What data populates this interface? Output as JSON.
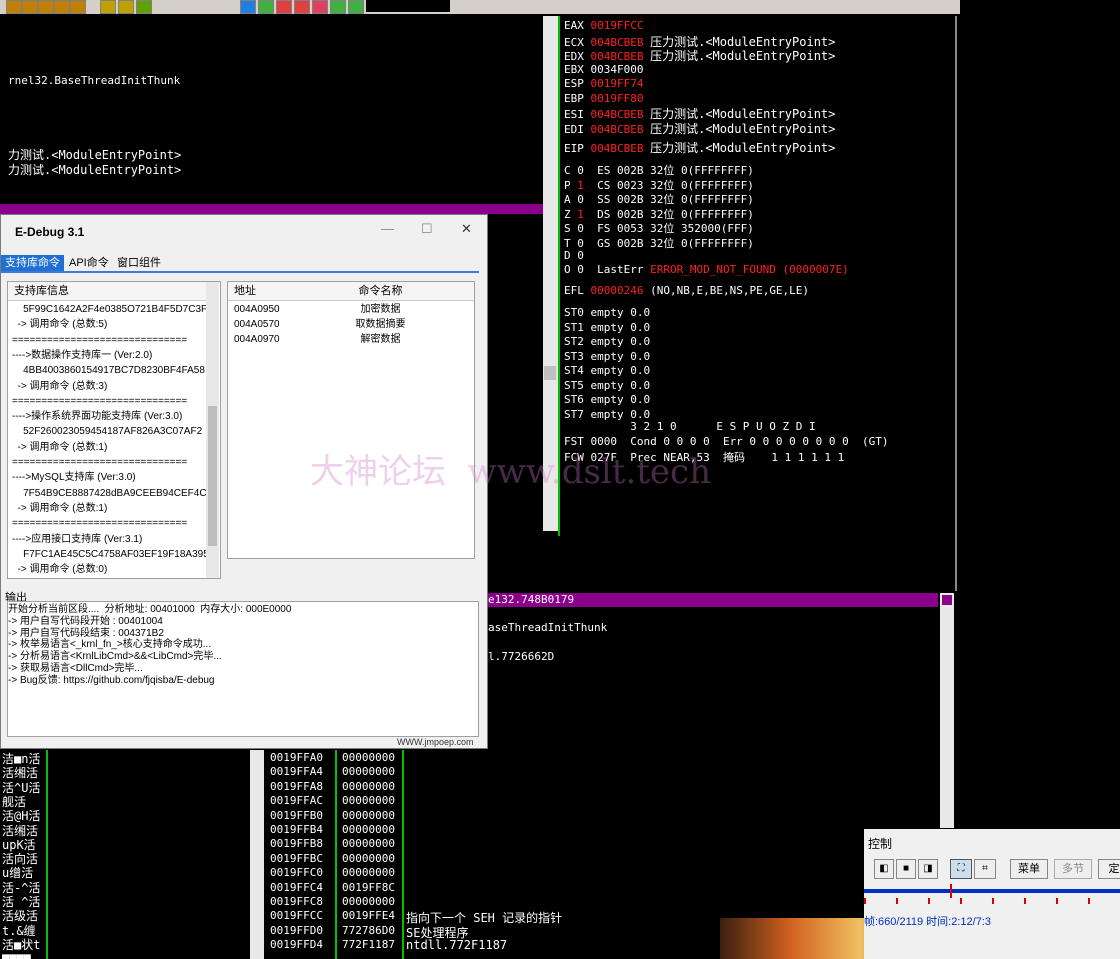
{
  "disasm": {
    "lines": [
      "rnel32.BaseThreadInitThunk",
      "力测试.<ModuleEntryPoint>",
      "力测试.<ModuleEntryPoint>"
    ]
  },
  "registers": {
    "lines": [
      {
        "name": "EAX",
        "value": "0019FFCC",
        "red": true,
        "extra": ""
      },
      {
        "name": "ECX",
        "value": "004BCBEB",
        "red": true,
        "extra": "压力测试.<ModuleEntryPoint>"
      },
      {
        "name": "EDX",
        "value": "004BCBEB",
        "red": true,
        "extra": "压力测试.<ModuleEntryPoint>"
      },
      {
        "name": "EBX",
        "value": "0034F000",
        "red": false,
        "extra": ""
      },
      {
        "name": "ESP",
        "value": "0019FF74",
        "red": true,
        "extra": ""
      },
      {
        "name": "EBP",
        "value": "0019FF80",
        "red": true,
        "extra": ""
      },
      {
        "name": "ESI",
        "value": "004BCBEB",
        "red": true,
        "extra": "压力测试.<ModuleEntryPoint>"
      },
      {
        "name": "EDI",
        "value": "004BCBEB",
        "red": true,
        "extra": "压力测试.<ModuleEntryPoint>"
      }
    ],
    "eip": {
      "name": "EIP",
      "value": "004BCBEB",
      "extra": "压力测试.<ModuleEntryPoint>"
    },
    "segs": [
      {
        "flag": "C 0",
        "seg": "ES 002B 32位 0(FFFFFFFF)"
      },
      {
        "flag": "P 1",
        "seg": "CS 0023 32位 0(FFFFFFFF)"
      },
      {
        "flag": "A 0",
        "seg": "SS 002B 32位 0(FFFFFFFF)"
      },
      {
        "flag": "Z 1",
        "seg": "DS 002B 32位 0(FFFFFFFF)"
      },
      {
        "flag": "S 0",
        "seg": "FS 0053 32位 352000(FFF)"
      },
      {
        "flag": "T 0",
        "seg": "GS 002B 32位 0(FFFFFFFF)"
      },
      {
        "flag": "D 0",
        "seg": ""
      }
    ],
    "lasterr": {
      "flag": "O 0",
      "label": "LastErr",
      "value": "ERROR_MOD_NOT_FOUND (0000007E)"
    },
    "efl": {
      "label": "EFL",
      "value": "00000246",
      "extra": "(NO,NB,E,BE,NS,PE,GE,LE)"
    },
    "fpu": [
      "ST0 empty 0.0",
      "ST1 empty 0.0",
      "ST2 empty 0.0",
      "ST3 empty 0.0",
      "ST4 empty 0.0",
      "ST5 empty 0.0",
      "ST6 empty 0.0",
      "ST7 empty 0.0"
    ],
    "fpu_hdr": "          3 2 1 0      E S P U O Z D I",
    "fst": "FST 0000  Cond 0 0 0 0  Err 0 0 0 0 0 0 0 0  (GT)",
    "fcw": "FCW 027F  Prec NEAR,53  掩码    1 1 1 1 1 1"
  },
  "watermark": "大神论坛  www.dslt.tech",
  "edebug": {
    "title": "E-Debug 3.1",
    "tabs": [
      "支持库命令",
      "API命令",
      "窗口组件"
    ],
    "lib_header": "支持库信息",
    "lib_rows": [
      "    5F99C1642A2F4e0385O721B4F5D7C3F",
      "  -> 调用命令 (总数:5)",
      "==============================",
      "---->数据操作支持库一 (Ver:2.0)",
      "    4BB4003860154917BC7D8230BF4FA58",
      "  -> 调用命令 (总数:3)",
      "==============================",
      "---->操作系统界面功能支持库 (Ver:3.0)",
      "    52F260023059454187AF826A3C07AF2",
      "  -> 调用命令 (总数:1)",
      "==============================",
      "---->MySQL支持库 (Ver:3.0)",
      "    7F54B9CE8887428dBA9CEEB94CEF4C7",
      "  -> 调用命令 (总数:1)",
      "==============================",
      "---->应用接口支持库 (Ver:3.1)",
      "    F7FC1AE45C5C4758AF03EF19F18A395",
      "  -> 调用命令 (总数:0)"
    ],
    "cmd_headers": [
      "地址",
      "命令名称"
    ],
    "cmd_rows": [
      {
        "addr": "004A0950",
        "name": "加密数据"
      },
      {
        "addr": "004A0570",
        "name": "取数据摘要"
      },
      {
        "addr": "004A0970",
        "name": "解密数据"
      }
    ],
    "output_label": "输出",
    "output_lines": [
      "开始分析当前区段....  分析地址: 00401000  内存大小: 000E0000",
      "-> 用户自写代码段开始 : 00401004",
      "-> 用户自写代码段结束 : 004371B2",
      "-> 枚举易语言<_krnl_fn_>核心支持命令成功...",
      "-> 分析易语言<KrnlLibCmd>&&<LibCmd>完毕...",
      "-> 获取易语言<DllCmd>完毕...",
      "-> Bug反馈: https://github.com/fjqisba/E-debug"
    ],
    "footer": "WWW.jmpoep.com"
  },
  "stackpane": {
    "header": "e132.748B0179",
    "lines": [
      "aseThreadInitThunk",
      "l.7726662D"
    ]
  },
  "stack": [
    {
      "addr": "0019FFA0",
      "val": "00000000",
      "cmt": ""
    },
    {
      "addr": "0019FFA4",
      "val": "00000000",
      "cmt": ""
    },
    {
      "addr": "0019FFA8",
      "val": "00000000",
      "cmt": ""
    },
    {
      "addr": "0019FFAC",
      "val": "00000000",
      "cmt": ""
    },
    {
      "addr": "0019FFB0",
      "val": "00000000",
      "cmt": ""
    },
    {
      "addr": "0019FFB4",
      "val": "00000000",
      "cmt": ""
    },
    {
      "addr": "0019FFB8",
      "val": "00000000",
      "cmt": ""
    },
    {
      "addr": "0019FFBC",
      "val": "00000000",
      "cmt": ""
    },
    {
      "addr": "0019FFC0",
      "val": "00000000",
      "cmt": ""
    },
    {
      "addr": "0019FFC4",
      "val": "0019FF8C",
      "cmt": ""
    },
    {
      "addr": "0019FFC8",
      "val": "00000000",
      "cmt": ""
    },
    {
      "addr": "0019FFCC",
      "val": "0019FFE4",
      "cmt": "指向下一个 SEH 记录的指针"
    },
    {
      "addr": "0019FFD0",
      "val": "772786D0",
      "cmt": "SE处理程序"
    },
    {
      "addr": "0019FFD4",
      "val": "772F1187",
      "cmt": "ntdll.772F1187"
    }
  ],
  "leftdump": [
    "洁■n活",
    "活缃活",
    "活^U活",
    "舰活",
    "活@H活",
    "活缃活",
    "upK活",
    "活向活",
    "u缯活",
    "活-^活",
    "活 ^活",
    "活级活",
    "t.&缠",
    "活■状t",
    "■■■■"
  ],
  "control": {
    "title": "控制",
    "menu_btn": "菜单",
    "chapter_btn": "多节",
    "more_btn": "定",
    "status": "帧:660/2119 时间:2:12/7:3"
  },
  "colors": {
    "purple": "#8b008b",
    "green": "#00c000",
    "red": "#ff2020"
  }
}
